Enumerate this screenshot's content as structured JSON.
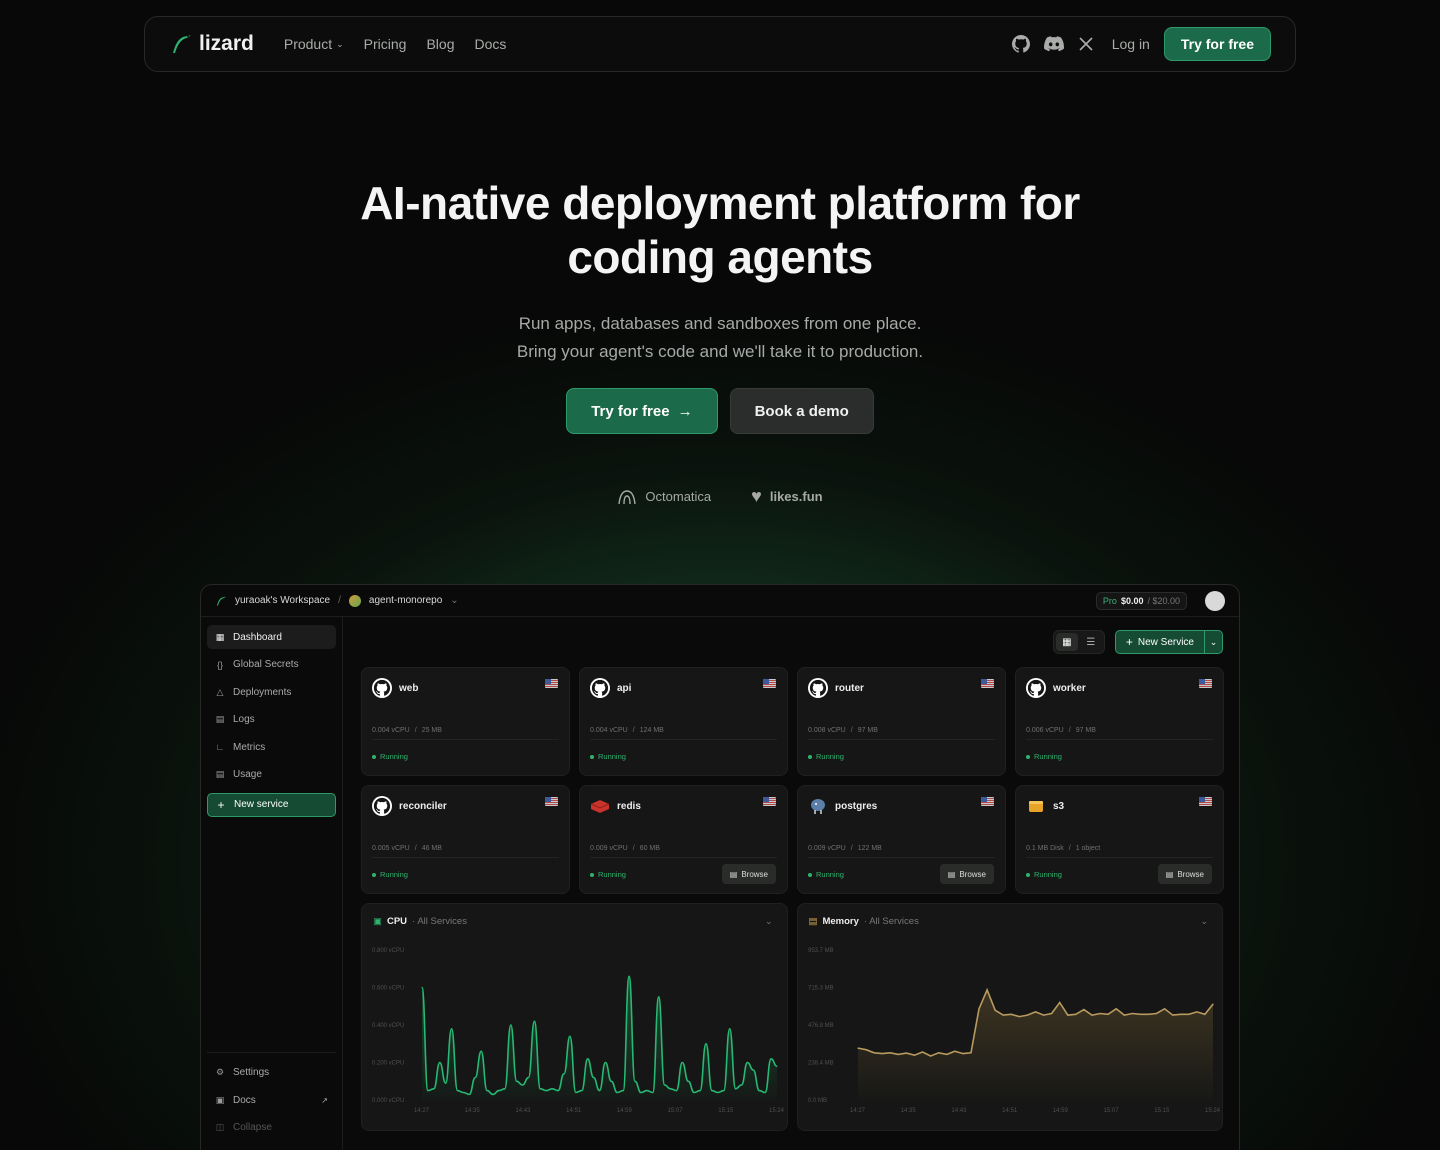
{
  "nav": {
    "brand": "lizard",
    "links": [
      {
        "label": "Product",
        "dropdown": true
      },
      {
        "label": "Pricing"
      },
      {
        "label": "Blog"
      },
      {
        "label": "Docs"
      }
    ],
    "icons": [
      "github-icon",
      "discord-icon",
      "x-icon"
    ],
    "login": "Log in",
    "cta": "Try for free"
  },
  "hero": {
    "title_line1": "AI-native deployment platform for",
    "title_line2": "coding agents",
    "sub_line1": "Run apps, databases and sandboxes from one place.",
    "sub_line2": "Bring your agent's code and we'll take it to production.",
    "cta_primary": "Try for free",
    "cta_secondary": "Book a demo",
    "logos": [
      "Octomatica",
      "likes.fun"
    ]
  },
  "app": {
    "workspace": "yuraoak's Workspace",
    "project": "agent-monorepo",
    "plan": {
      "tier": "Pro",
      "spent": "$0.00",
      "limit": "/ $20.00"
    },
    "sidebar": {
      "items": [
        {
          "label": "Dashboard",
          "icon": "grid-icon",
          "active": true
        },
        {
          "label": "Global Secrets",
          "icon": "braces-icon"
        },
        {
          "label": "Deployments",
          "icon": "rocket-icon"
        },
        {
          "label": "Logs",
          "icon": "logs-icon"
        },
        {
          "label": "Metrics",
          "icon": "chart-icon"
        },
        {
          "label": "Usage",
          "icon": "usage-icon"
        }
      ],
      "new_service": "New service",
      "bottom": [
        {
          "label": "Settings",
          "icon": "gear-icon"
        },
        {
          "label": "Docs",
          "icon": "book-icon"
        },
        {
          "label": "Collapse",
          "icon": "collapse-icon"
        }
      ]
    },
    "toolbar": {
      "new_service": "New Service"
    },
    "services": [
      {
        "name": "web",
        "icon": "github",
        "cpu": "0.004 vCPU",
        "mem": "25 MB",
        "status": "Running",
        "browse": ""
      },
      {
        "name": "api",
        "icon": "github",
        "cpu": "0.004 vCPU",
        "mem": "124 MB",
        "status": "Running",
        "browse": ""
      },
      {
        "name": "router",
        "icon": "github",
        "cpu": "0.008 vCPU",
        "mem": "97 MB",
        "status": "Running",
        "browse": ""
      },
      {
        "name": "worker",
        "icon": "github",
        "cpu": "0.006 vCPU",
        "mem": "97 MB",
        "status": "Running",
        "browse": ""
      },
      {
        "name": "reconciler",
        "icon": "github",
        "cpu": "0.005 vCPU",
        "mem": "46 MB",
        "status": "Running",
        "browse": ""
      },
      {
        "name": "redis",
        "icon": "redis",
        "cpu": "0.009 vCPU",
        "mem": "60 MB",
        "status": "Running",
        "browse": "Browse"
      },
      {
        "name": "postgres",
        "icon": "postgres",
        "cpu": "0.009 vCPU",
        "mem": "122 MB",
        "status": "Running",
        "browse": "Browse"
      },
      {
        "name": "s3",
        "icon": "s3",
        "cpu": "0.1 MB Disk",
        "mem": "1 object",
        "status": "Running",
        "browse": "Browse"
      }
    ],
    "colors": {
      "accent": "#1b6b4b",
      "running": "#2fb36f",
      "cpu_line": "#27b873",
      "mem_line": "#b89a5e"
    }
  },
  "chart_data": [
    {
      "type": "line",
      "title": "CPU",
      "subtitle": "· All Services",
      "ylim": [
        0,
        0.8
      ],
      "yticks": [
        "0.800 vCPU",
        "0.600 vCPU",
        "0.400 vCPU",
        "0.200 vCPU",
        "0.000 vCPU"
      ],
      "x": [
        "14:27",
        "14:35",
        "14:43",
        "14:51",
        "14:59",
        "15:07",
        "15:15",
        "15:24"
      ],
      "values": [
        0.6,
        0.05,
        0.06,
        0.2,
        0.09,
        0.38,
        0.05,
        0.04,
        0.03,
        0.12,
        0.26,
        0.05,
        0.03,
        0.05,
        0.06,
        0.4,
        0.1,
        0.08,
        0.12,
        0.42,
        0.06,
        0.05,
        0.06,
        0.05,
        0.14,
        0.34,
        0.04,
        0.05,
        0.22,
        0.12,
        0.05,
        0.2,
        0.1,
        0.04,
        0.05,
        0.66,
        0.1,
        0.04,
        0.05,
        0.04,
        0.55,
        0.08,
        0.06,
        0.05,
        0.2,
        0.1,
        0.04,
        0.05,
        0.3,
        0.05,
        0.04,
        0.05,
        0.38,
        0.06,
        0.08,
        0.2,
        0.16,
        0.05,
        0.04,
        0.22,
        0.18
      ]
    },
    {
      "type": "area",
      "title": "Memory",
      "subtitle": "· All Services",
      "ylim": [
        0,
        953.7
      ],
      "yticks": [
        "953.7 MB",
        "715.3 MB",
        "476.8 MB",
        "238.4 MB",
        "0.0 MB"
      ],
      "x": [
        "14:27",
        "14:35",
        "14:43",
        "14:51",
        "14:59",
        "15:07",
        "15:15",
        "15:24"
      ],
      "values": [
        330,
        320,
        300,
        295,
        300,
        290,
        298,
        285,
        305,
        280,
        300,
        290,
        310,
        295,
        300,
        580,
        700,
        570,
        540,
        545,
        530,
        540,
        560,
        540,
        550,
        620,
        540,
        545,
        575,
        540,
        550,
        545,
        580,
        540,
        550,
        545,
        545,
        550,
        580,
        540,
        545,
        545,
        560,
        545,
        610
      ]
    }
  ]
}
